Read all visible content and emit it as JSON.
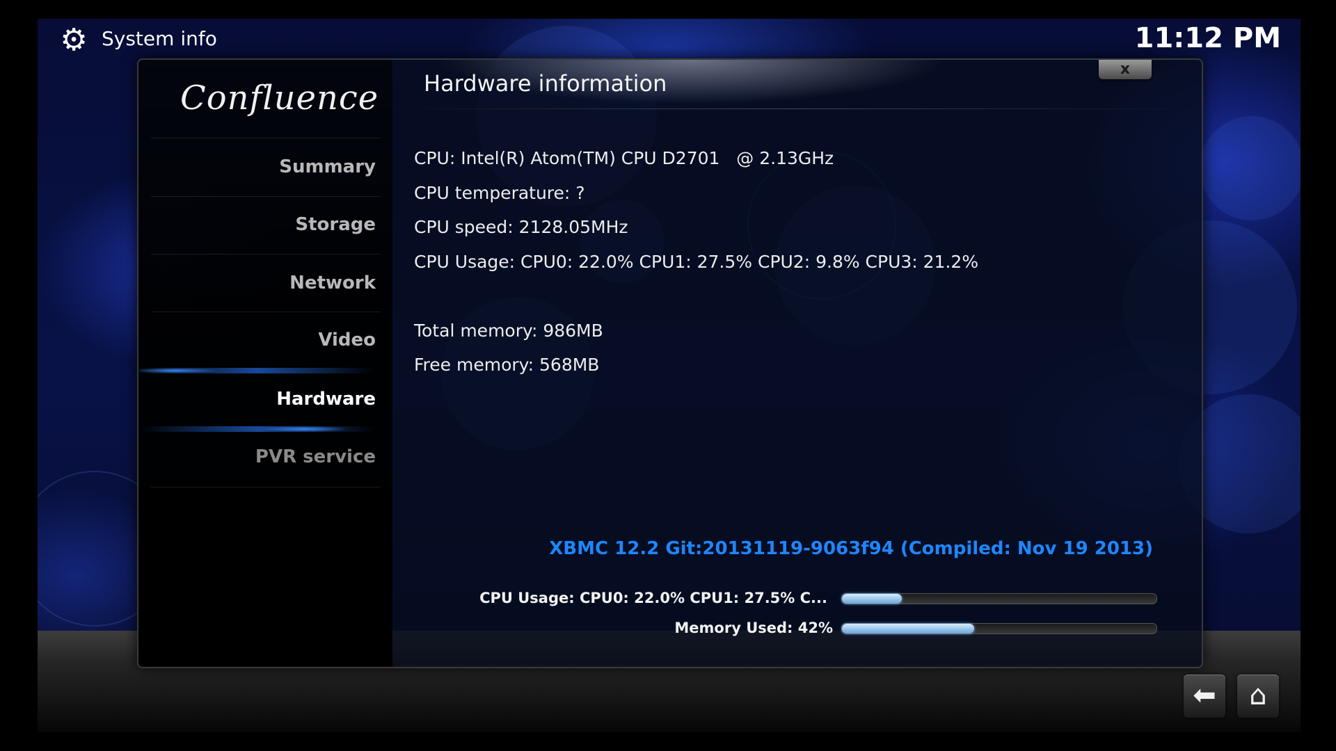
{
  "header": {
    "section_title": "System info",
    "clock": "11:12 PM",
    "icon": "gear-icon"
  },
  "sidebar": {
    "logo_text": "Confluence",
    "items": [
      {
        "label": "Summary",
        "state": "normal"
      },
      {
        "label": "Storage",
        "state": "normal"
      },
      {
        "label": "Network",
        "state": "normal"
      },
      {
        "label": "Video",
        "state": "normal"
      },
      {
        "label": "Hardware",
        "state": "selected"
      },
      {
        "label": "PVR service",
        "state": "disabled"
      }
    ]
  },
  "main": {
    "title": "Hardware information",
    "close_label": "x",
    "info_lines": [
      "CPU: Intel(R) Atom(TM) CPU D2701   @ 2.13GHz",
      "CPU temperature: ?",
      "CPU speed: 2128.05MHz",
      "CPU Usage: CPU0: 22.0% CPU1: 27.5% CPU2: 9.8% CPU3: 21.2%",
      "Total memory: 986MB",
      "Free memory: 568MB"
    ],
    "version": "XBMC 12.2 Git:20131119-9063f94 (Compiled: Nov 19 2013)",
    "bars": [
      {
        "label": "CPU Usage: CPU0: 22.0% CPU1: 27.5% C...",
        "value_percent": 19
      },
      {
        "label": "Memory Used: 42%",
        "value_percent": 42
      }
    ]
  },
  "footer": {
    "back_icon": "back-arrow-icon",
    "home_icon": "home-icon"
  },
  "colors": {
    "accent": "#1e86ff",
    "background": "#081247",
    "progress_fill": "#a9d0f2"
  }
}
